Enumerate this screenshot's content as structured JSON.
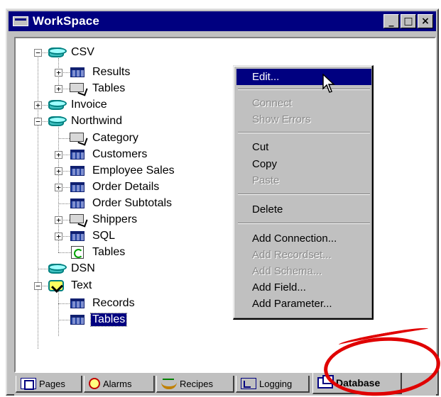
{
  "window": {
    "title": "WorkSpace",
    "controls": [
      "_",
      "□",
      "×"
    ]
  },
  "tree": {
    "csv": "CSV",
    "csv_results": "Results",
    "csv_tables": "Tables",
    "invoice": "Invoice",
    "northwind": "Northwind",
    "nw_category": "Category",
    "nw_customers": "Customers",
    "nw_employee_sales": "Employee Sales",
    "nw_order_details": "Order Details",
    "nw_order_subtotals": "Order Subtotals",
    "nw_shippers": "Shippers",
    "nw_sql": "SQL",
    "nw_tables": "Tables",
    "dsn": "DSN",
    "text": "Text",
    "text_records": "Records",
    "text_tables": "Tables",
    "selected": "Tables"
  },
  "context_menu": {
    "edit": "Edit...",
    "connect": "Connect",
    "show_errors": "Show Errors",
    "cut": "Cut",
    "copy": "Copy",
    "paste": "Paste",
    "delete": "Delete",
    "add_connection": "Add Connection...",
    "add_recordset": "Add Recordset...",
    "add_schema": "Add Schema...",
    "add_field": "Add Field...",
    "add_parameter": "Add Parameter..."
  },
  "tabs": {
    "pages": "Pages",
    "alarms": "Alarms",
    "recipes": "Recipes",
    "logging": "Logging",
    "database": "Database",
    "active": "Database"
  },
  "icons": {
    "database": "database-icon",
    "table": "table-icon",
    "query": "query-icon",
    "refresh": "refresh-icon",
    "text_db": "text-datasource-icon"
  },
  "colors": {
    "title_bar": "#000080",
    "highlight": "#000080",
    "annotation": "#e00000"
  }
}
